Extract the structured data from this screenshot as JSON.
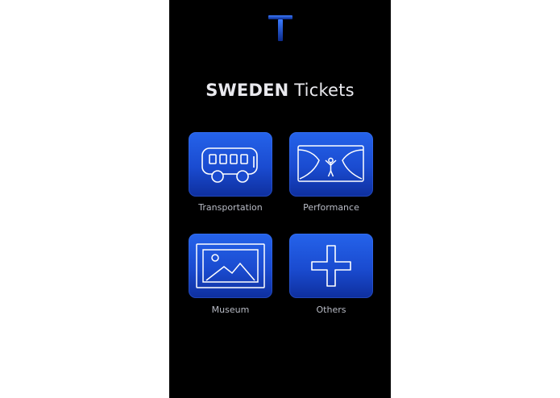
{
  "app": {
    "title_bold": "SWEDEN",
    "title_rest": " Tickets"
  },
  "tiles": [
    {
      "label": "Transportation",
      "icon": "bus-icon"
    },
    {
      "label": "Performance",
      "icon": "stage-performer-icon"
    },
    {
      "label": "Museum",
      "icon": "framed-picture-icon"
    },
    {
      "label": "Others",
      "icon": "plus-icon"
    }
  ],
  "colors": {
    "background": "#000000",
    "accent": "#1f55e0",
    "logo": "#2f6bff",
    "label_text": "#b9bcc6"
  }
}
